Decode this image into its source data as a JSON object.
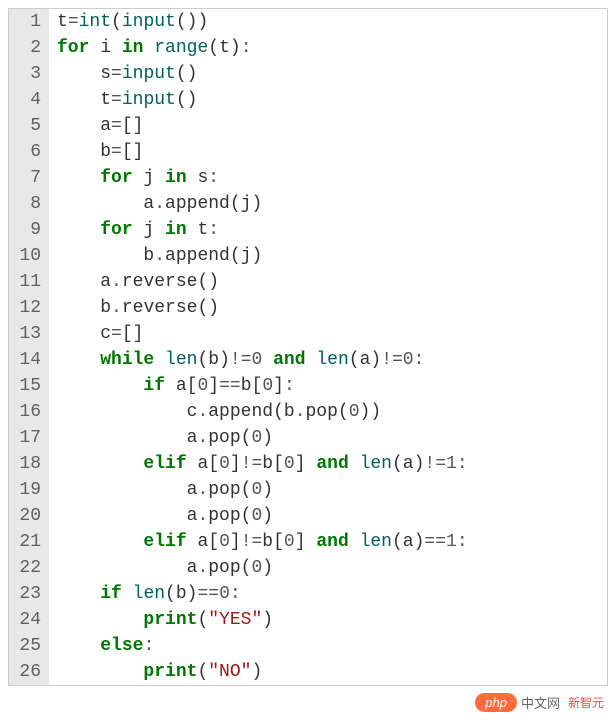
{
  "code_lines": [
    {
      "n": 1,
      "tokens": [
        {
          "t": "t",
          "c": "name"
        },
        {
          "t": "=",
          "c": "op"
        },
        {
          "t": "int",
          "c": "builtin"
        },
        {
          "t": "(",
          "c": "paren"
        },
        {
          "t": "input",
          "c": "builtin"
        },
        {
          "t": "()",
          "c": "paren"
        },
        {
          "t": ")",
          "c": "paren"
        }
      ],
      "indent": 0
    },
    {
      "n": 2,
      "tokens": [
        {
          "t": "for",
          "c": "kw"
        },
        {
          "t": " i ",
          "c": "name"
        },
        {
          "t": "in",
          "c": "kw"
        },
        {
          "t": " ",
          "c": "name"
        },
        {
          "t": "range",
          "c": "builtin"
        },
        {
          "t": "(",
          "c": "paren"
        },
        {
          "t": "t",
          "c": "name"
        },
        {
          "t": ")",
          "c": "paren"
        },
        {
          "t": ":",
          "c": "op"
        }
      ],
      "indent": 0
    },
    {
      "n": 3,
      "tokens": [
        {
          "t": "s",
          "c": "name"
        },
        {
          "t": "=",
          "c": "op"
        },
        {
          "t": "input",
          "c": "builtin"
        },
        {
          "t": "()",
          "c": "paren"
        }
      ],
      "indent": 1
    },
    {
      "n": 4,
      "tokens": [
        {
          "t": "t",
          "c": "name"
        },
        {
          "t": "=",
          "c": "op"
        },
        {
          "t": "input",
          "c": "builtin"
        },
        {
          "t": "()",
          "c": "paren"
        }
      ],
      "indent": 1
    },
    {
      "n": 5,
      "tokens": [
        {
          "t": "a",
          "c": "name"
        },
        {
          "t": "=",
          "c": "op"
        },
        {
          "t": "[]",
          "c": "paren"
        }
      ],
      "indent": 1
    },
    {
      "n": 6,
      "tokens": [
        {
          "t": "b",
          "c": "name"
        },
        {
          "t": "=",
          "c": "op"
        },
        {
          "t": "[]",
          "c": "paren"
        }
      ],
      "indent": 1
    },
    {
      "n": 7,
      "tokens": [
        {
          "t": "for",
          "c": "kw"
        },
        {
          "t": " j ",
          "c": "name"
        },
        {
          "t": "in",
          "c": "kw"
        },
        {
          "t": " s",
          "c": "name"
        },
        {
          "t": ":",
          "c": "op"
        }
      ],
      "indent": 1
    },
    {
      "n": 8,
      "tokens": [
        {
          "t": "a",
          "c": "name"
        },
        {
          "t": ".",
          "c": "op"
        },
        {
          "t": "append",
          "c": "name"
        },
        {
          "t": "(",
          "c": "paren"
        },
        {
          "t": "j",
          "c": "name"
        },
        {
          "t": ")",
          "c": "paren"
        }
      ],
      "indent": 2
    },
    {
      "n": 9,
      "tokens": [
        {
          "t": "for",
          "c": "kw"
        },
        {
          "t": " j ",
          "c": "name"
        },
        {
          "t": "in",
          "c": "kw"
        },
        {
          "t": " t",
          "c": "name"
        },
        {
          "t": ":",
          "c": "op"
        }
      ],
      "indent": 1
    },
    {
      "n": 10,
      "tokens": [
        {
          "t": "b",
          "c": "name"
        },
        {
          "t": ".",
          "c": "op"
        },
        {
          "t": "append",
          "c": "name"
        },
        {
          "t": "(",
          "c": "paren"
        },
        {
          "t": "j",
          "c": "name"
        },
        {
          "t": ")",
          "c": "paren"
        }
      ],
      "indent": 2
    },
    {
      "n": 11,
      "tokens": [
        {
          "t": "a",
          "c": "name"
        },
        {
          "t": ".",
          "c": "op"
        },
        {
          "t": "reverse",
          "c": "name"
        },
        {
          "t": "()",
          "c": "paren"
        }
      ],
      "indent": 1
    },
    {
      "n": 12,
      "tokens": [
        {
          "t": "b",
          "c": "name"
        },
        {
          "t": ".",
          "c": "op"
        },
        {
          "t": "reverse",
          "c": "name"
        },
        {
          "t": "()",
          "c": "paren"
        }
      ],
      "indent": 1
    },
    {
      "n": 13,
      "tokens": [
        {
          "t": "c",
          "c": "name"
        },
        {
          "t": "=",
          "c": "op"
        },
        {
          "t": "[]",
          "c": "paren"
        }
      ],
      "indent": 1
    },
    {
      "n": 14,
      "tokens": [
        {
          "t": "while",
          "c": "kw"
        },
        {
          "t": " ",
          "c": "name"
        },
        {
          "t": "len",
          "c": "builtin"
        },
        {
          "t": "(",
          "c": "paren"
        },
        {
          "t": "b",
          "c": "name"
        },
        {
          "t": ")",
          "c": "paren"
        },
        {
          "t": "!=",
          "c": "op"
        },
        {
          "t": "0",
          "c": "num"
        },
        {
          "t": " ",
          "c": "name"
        },
        {
          "t": "and",
          "c": "kw"
        },
        {
          "t": " ",
          "c": "name"
        },
        {
          "t": "len",
          "c": "builtin"
        },
        {
          "t": "(",
          "c": "paren"
        },
        {
          "t": "a",
          "c": "name"
        },
        {
          "t": ")",
          "c": "paren"
        },
        {
          "t": "!=",
          "c": "op"
        },
        {
          "t": "0",
          "c": "num"
        },
        {
          "t": ":",
          "c": "op"
        }
      ],
      "indent": 1
    },
    {
      "n": 15,
      "tokens": [
        {
          "t": "if",
          "c": "kw"
        },
        {
          "t": " a",
          "c": "name"
        },
        {
          "t": "[",
          "c": "paren"
        },
        {
          "t": "0",
          "c": "num"
        },
        {
          "t": "]",
          "c": "paren"
        },
        {
          "t": "==",
          "c": "op"
        },
        {
          "t": "b",
          "c": "name"
        },
        {
          "t": "[",
          "c": "paren"
        },
        {
          "t": "0",
          "c": "num"
        },
        {
          "t": "]",
          "c": "paren"
        },
        {
          "t": ":",
          "c": "op"
        }
      ],
      "indent": 2
    },
    {
      "n": 16,
      "tokens": [
        {
          "t": "c",
          "c": "name"
        },
        {
          "t": ".",
          "c": "op"
        },
        {
          "t": "append",
          "c": "name"
        },
        {
          "t": "(",
          "c": "paren"
        },
        {
          "t": "b",
          "c": "name"
        },
        {
          "t": ".",
          "c": "op"
        },
        {
          "t": "pop",
          "c": "name"
        },
        {
          "t": "(",
          "c": "paren"
        },
        {
          "t": "0",
          "c": "num"
        },
        {
          "t": ")",
          "c": "paren"
        },
        {
          "t": ")",
          "c": "paren"
        }
      ],
      "indent": 3
    },
    {
      "n": 17,
      "tokens": [
        {
          "t": "a",
          "c": "name"
        },
        {
          "t": ".",
          "c": "op"
        },
        {
          "t": "pop",
          "c": "name"
        },
        {
          "t": "(",
          "c": "paren"
        },
        {
          "t": "0",
          "c": "num"
        },
        {
          "t": ")",
          "c": "paren"
        }
      ],
      "indent": 3
    },
    {
      "n": 18,
      "tokens": [
        {
          "t": "elif",
          "c": "kw"
        },
        {
          "t": " a",
          "c": "name"
        },
        {
          "t": "[",
          "c": "paren"
        },
        {
          "t": "0",
          "c": "num"
        },
        {
          "t": "]",
          "c": "paren"
        },
        {
          "t": "!=",
          "c": "op"
        },
        {
          "t": "b",
          "c": "name"
        },
        {
          "t": "[",
          "c": "paren"
        },
        {
          "t": "0",
          "c": "num"
        },
        {
          "t": "]",
          "c": "paren"
        },
        {
          "t": " ",
          "c": "name"
        },
        {
          "t": "and",
          "c": "kw"
        },
        {
          "t": " ",
          "c": "name"
        },
        {
          "t": "len",
          "c": "builtin"
        },
        {
          "t": "(",
          "c": "paren"
        },
        {
          "t": "a",
          "c": "name"
        },
        {
          "t": ")",
          "c": "paren"
        },
        {
          "t": "!=",
          "c": "op"
        },
        {
          "t": "1",
          "c": "num"
        },
        {
          "t": ":",
          "c": "op"
        }
      ],
      "indent": 2
    },
    {
      "n": 19,
      "tokens": [
        {
          "t": "a",
          "c": "name"
        },
        {
          "t": ".",
          "c": "op"
        },
        {
          "t": "pop",
          "c": "name"
        },
        {
          "t": "(",
          "c": "paren"
        },
        {
          "t": "0",
          "c": "num"
        },
        {
          "t": ")",
          "c": "paren"
        }
      ],
      "indent": 3
    },
    {
      "n": 20,
      "tokens": [
        {
          "t": "a",
          "c": "name"
        },
        {
          "t": ".",
          "c": "op"
        },
        {
          "t": "pop",
          "c": "name"
        },
        {
          "t": "(",
          "c": "paren"
        },
        {
          "t": "0",
          "c": "num"
        },
        {
          "t": ")",
          "c": "paren"
        }
      ],
      "indent": 3
    },
    {
      "n": 21,
      "tokens": [
        {
          "t": "elif",
          "c": "kw"
        },
        {
          "t": " a",
          "c": "name"
        },
        {
          "t": "[",
          "c": "paren"
        },
        {
          "t": "0",
          "c": "num"
        },
        {
          "t": "]",
          "c": "paren"
        },
        {
          "t": "!=",
          "c": "op"
        },
        {
          "t": "b",
          "c": "name"
        },
        {
          "t": "[",
          "c": "paren"
        },
        {
          "t": "0",
          "c": "num"
        },
        {
          "t": "]",
          "c": "paren"
        },
        {
          "t": " ",
          "c": "name"
        },
        {
          "t": "and",
          "c": "kw"
        },
        {
          "t": " ",
          "c": "name"
        },
        {
          "t": "len",
          "c": "builtin"
        },
        {
          "t": "(",
          "c": "paren"
        },
        {
          "t": "a",
          "c": "name"
        },
        {
          "t": ")",
          "c": "paren"
        },
        {
          "t": "==",
          "c": "op"
        },
        {
          "t": "1",
          "c": "num"
        },
        {
          "t": ":",
          "c": "op"
        }
      ],
      "indent": 2
    },
    {
      "n": 22,
      "tokens": [
        {
          "t": "a",
          "c": "name"
        },
        {
          "t": ".",
          "c": "op"
        },
        {
          "t": "pop",
          "c": "name"
        },
        {
          "t": "(",
          "c": "paren"
        },
        {
          "t": "0",
          "c": "num"
        },
        {
          "t": ")",
          "c": "paren"
        }
      ],
      "indent": 3
    },
    {
      "n": 23,
      "tokens": [
        {
          "t": "if",
          "c": "kw"
        },
        {
          "t": " ",
          "c": "name"
        },
        {
          "t": "len",
          "c": "builtin"
        },
        {
          "t": "(",
          "c": "paren"
        },
        {
          "t": "b",
          "c": "name"
        },
        {
          "t": ")",
          "c": "paren"
        },
        {
          "t": "==",
          "c": "op"
        },
        {
          "t": "0",
          "c": "num"
        },
        {
          "t": ":",
          "c": "op"
        }
      ],
      "indent": 1
    },
    {
      "n": 24,
      "tokens": [
        {
          "t": "print",
          "c": "kw"
        },
        {
          "t": "(",
          "c": "paren"
        },
        {
          "t": "\"YES\"",
          "c": "str"
        },
        {
          "t": ")",
          "c": "paren"
        }
      ],
      "indent": 2
    },
    {
      "n": 25,
      "tokens": [
        {
          "t": "else",
          "c": "kw"
        },
        {
          "t": ":",
          "c": "op"
        }
      ],
      "indent": 1
    },
    {
      "n": 26,
      "tokens": [
        {
          "t": "print",
          "c": "kw"
        },
        {
          "t": "(",
          "c": "paren"
        },
        {
          "t": "\"NO\"",
          "c": "str"
        },
        {
          "t": ")",
          "c": "paren"
        }
      ],
      "indent": 2
    }
  ],
  "watermark": {
    "badge": "php",
    "text": "中文网",
    "sub": "新智元"
  }
}
